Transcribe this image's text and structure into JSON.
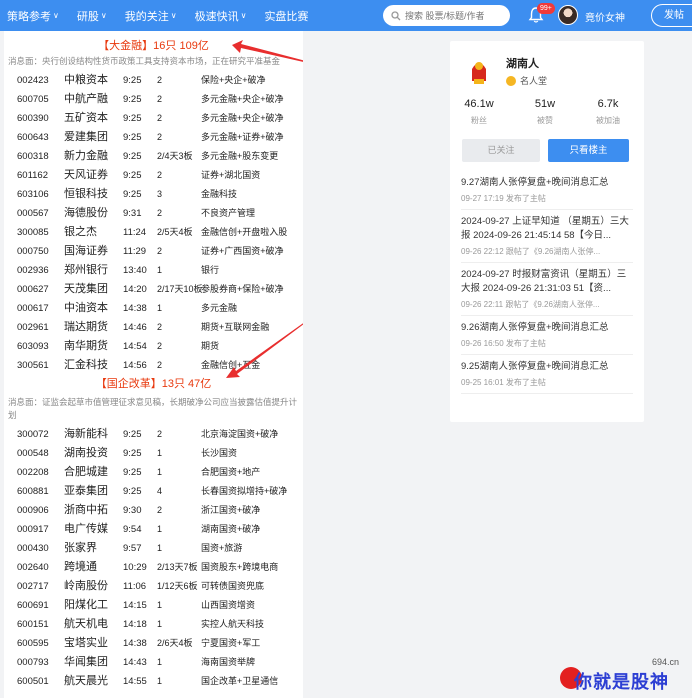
{
  "nav": {
    "items": [
      {
        "label": "策略参考",
        "caret": true
      },
      {
        "label": "研股",
        "caret": true
      },
      {
        "label": "我的关注",
        "caret": true
      },
      {
        "label": "极速快讯",
        "caret": true
      },
      {
        "label": "实盘比赛",
        "caret": false
      }
    ],
    "search_placeholder": "搜索 股票/标题/作者",
    "badge": "99+",
    "username": "竟价女神",
    "post_button": "发帖"
  },
  "article": {
    "sections": [
      {
        "title": "【大金融】16只 109亿",
        "note": "消息面：央行创设结构性货币政策工具支持资本市场，正在研究平准基金",
        "rows": [
          [
            "002423",
            "中粮资本",
            "9:25",
            "2",
            "保险+央企+破净"
          ],
          [
            "600705",
            "中航产融",
            "9:25",
            "2",
            "多元金融+央企+破净"
          ],
          [
            "600390",
            "五矿资本",
            "9:25",
            "2",
            "多元金融+央企+破净"
          ],
          [
            "600643",
            "爱建集团",
            "9:25",
            "2",
            "多元金融+证券+破净"
          ],
          [
            "600318",
            "新力金融",
            "9:25",
            "2/4天3板",
            "多元金融+股东变更"
          ],
          [
            "601162",
            "天风证券",
            "9:25",
            "2",
            "证券+湖北国资"
          ],
          [
            "603106",
            "恒银科技",
            "9:25",
            "3",
            "金融科技"
          ],
          [
            "000567",
            "海德股份",
            "9:31",
            "2",
            "不良资产管理"
          ],
          [
            "300085",
            "银之杰",
            "11:24",
            "2/5天4板",
            "金融信创+开盘啦入股"
          ],
          [
            "000750",
            "国海证券",
            "11:29",
            "2",
            "证券+广西国资+破净"
          ],
          [
            "002936",
            "郑州银行",
            "13:40",
            "1",
            "银行"
          ],
          [
            "000627",
            "天茂集团",
            "14:20",
            "2/17天10板",
            "参股券商+保险+破净"
          ],
          [
            "000617",
            "中油资本",
            "14:38",
            "1",
            "多元金融"
          ],
          [
            "002961",
            "瑞达期货",
            "14:46",
            "2",
            "期货+互联网金融"
          ],
          [
            "603093",
            "南华期货",
            "14:54",
            "2",
            "期货"
          ],
          [
            "300561",
            "汇金科技",
            "14:56",
            "2",
            "金融信创+互金"
          ]
        ]
      },
      {
        "title": "【国企改革】13只 47亿",
        "note": "消息面：证监会起草市值管理征求意见稿，长期破净公司应当披露估值提升计划",
        "rows": [
          [
            "300072",
            "海新能科",
            "9:25",
            "2",
            "北京海淀国资+破净"
          ],
          [
            "000548",
            "湖南投资",
            "9:25",
            "1",
            "长沙国资"
          ],
          [
            "002208",
            "合肥城建",
            "9:25",
            "1",
            "合肥国资+地产"
          ],
          [
            "600881",
            "亚泰集团",
            "9:25",
            "4",
            "长春国资拟增持+破净"
          ],
          [
            "000906",
            "浙商中拓",
            "9:30",
            "2",
            "浙江国资+破净"
          ],
          [
            "000917",
            "电广传媒",
            "9:54",
            "1",
            "湖南国资+破净"
          ],
          [
            "000430",
            "张家界",
            "9:57",
            "1",
            "国资+旅游"
          ],
          [
            "002640",
            "跨境通",
            "10:29",
            "2/13天7板",
            "国资股东+跨境电商"
          ],
          [
            "002717",
            "岭南股份",
            "11:06",
            "1/12天6板",
            "可转债国资兜底"
          ],
          [
            "600691",
            "阳煤化工",
            "14:15",
            "1",
            "山西国资增资"
          ],
          [
            "600151",
            "航天机电",
            "14:18",
            "1",
            "实控人航天科技"
          ],
          [
            "600595",
            "宝塔实业",
            "14:38",
            "2/6天4板",
            "宁夏国资+军工"
          ],
          [
            "000793",
            "华闻集团",
            "14:43",
            "1",
            "海南国资举牌"
          ],
          [
            "600501",
            "航天晨光",
            "14:55",
            "1",
            "国企改革+卫星通信"
          ]
        ]
      }
    ]
  },
  "side": {
    "author": "湖南人",
    "role": "名人堂",
    "stats": [
      {
        "num": "46.1w",
        "label": "粉丝"
      },
      {
        "num": "51w",
        "label": "被赞"
      },
      {
        "num": "6.7k",
        "label": "被加油"
      }
    ],
    "followed_label": "已关注",
    "only_host_label": "只看楼主",
    "posts": [
      {
        "title": "9.27湖南人张停复盘+晚间消息汇总",
        "meta": "09-27 17:19 发布了主帖"
      },
      {
        "title": "2024-09-27 上证早知道 （星期五）三大报 2024-09-26 21:45:14 58【今日...",
        "meta": "09-26 22:12 跟帖了《9.26湖南人张停..."
      },
      {
        "title": "2024-09-27 时报财富资讯（星期五）三大报 2024-09-26 21:31:03 51【资...",
        "meta": "09-26 22:11 跟帖了《9.26湖南人张停..."
      },
      {
        "title": "9.26湖南人张停复盘+晚间消息汇总",
        "meta": "09-26 16:50 发布了主帖"
      },
      {
        "title": "9.25湖南人张停复盘+晚间消息汇总",
        "meta": "09-25 16:01 发布了主帖"
      }
    ]
  },
  "watermark": {
    "site": "694.cn",
    "brand": "你就是股神"
  },
  "colors": {
    "nav": "#3d8ef0",
    "section_title": "#e8380d",
    "arrow": "#e82e2e",
    "watermark": "#2d3fd3"
  }
}
